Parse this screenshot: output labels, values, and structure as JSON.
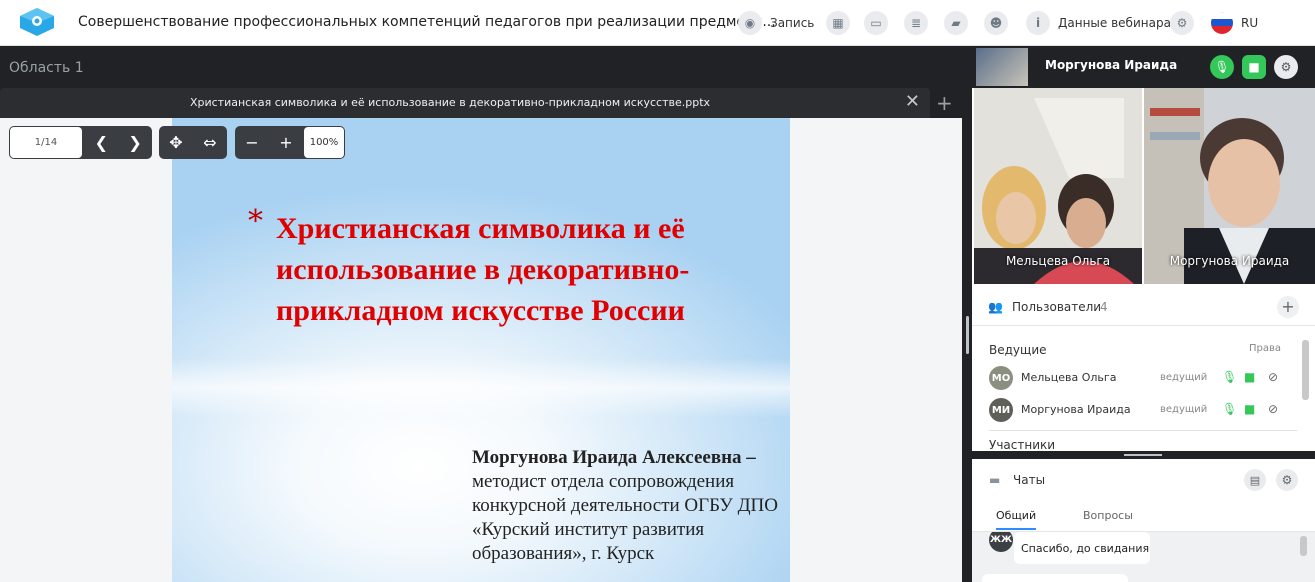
{
  "app": {
    "title": "Совершенствование профессиональных компетенций педагогов при реализации предметн...",
    "logo_icon": "webinar-logo-icon"
  },
  "toolbar": {
    "record_label": "Запись",
    "webinar_data_label": "Данные вебинара",
    "language": "RU"
  },
  "area": {
    "title": "Область 1"
  },
  "document": {
    "tab_title": "Христианская символика и её использование в декоративно-прикладном искусстве.pptx",
    "page_indicator": "1/14",
    "zoom": "100%"
  },
  "slide": {
    "star": "*",
    "title": "Христианская символика и её использование в декоративно-прикладном искусстве России",
    "author_name": "Моргунова Ираида Алексеевна –",
    "author_desc": "методист отдела сопровождения конкурсной деятельности ОГБУ ДПО «Курский институт развития образования», г. Курск"
  },
  "video": {
    "presenter_name": "Моргунова Ираида",
    "tiles": [
      {
        "name": "Мельцева Ольга"
      },
      {
        "name": "Моргунова Ираида"
      }
    ]
  },
  "users": {
    "label": "Пользователи",
    "count": "4",
    "hosts_heading": "Ведущие",
    "rights_label": "Права",
    "participants_heading": "Участники",
    "hosts": [
      {
        "initials": "МО",
        "name": "Мельцева Ольга",
        "role": "ведущий",
        "color": "#8a8f80"
      },
      {
        "initials": "МИ",
        "name": "Моргунова Ираида",
        "role": "ведущий",
        "color": "#5e5f59"
      }
    ]
  },
  "chat": {
    "label": "Чаты",
    "tabs": [
      "Общий",
      "Вопросы"
    ],
    "messages": [
      {
        "initials": "ЖЖ",
        "text": "Спасибо, до свидания"
      }
    ]
  },
  "colors": {
    "accent_green": "#34c759",
    "slide_title_red": "#e00000"
  }
}
